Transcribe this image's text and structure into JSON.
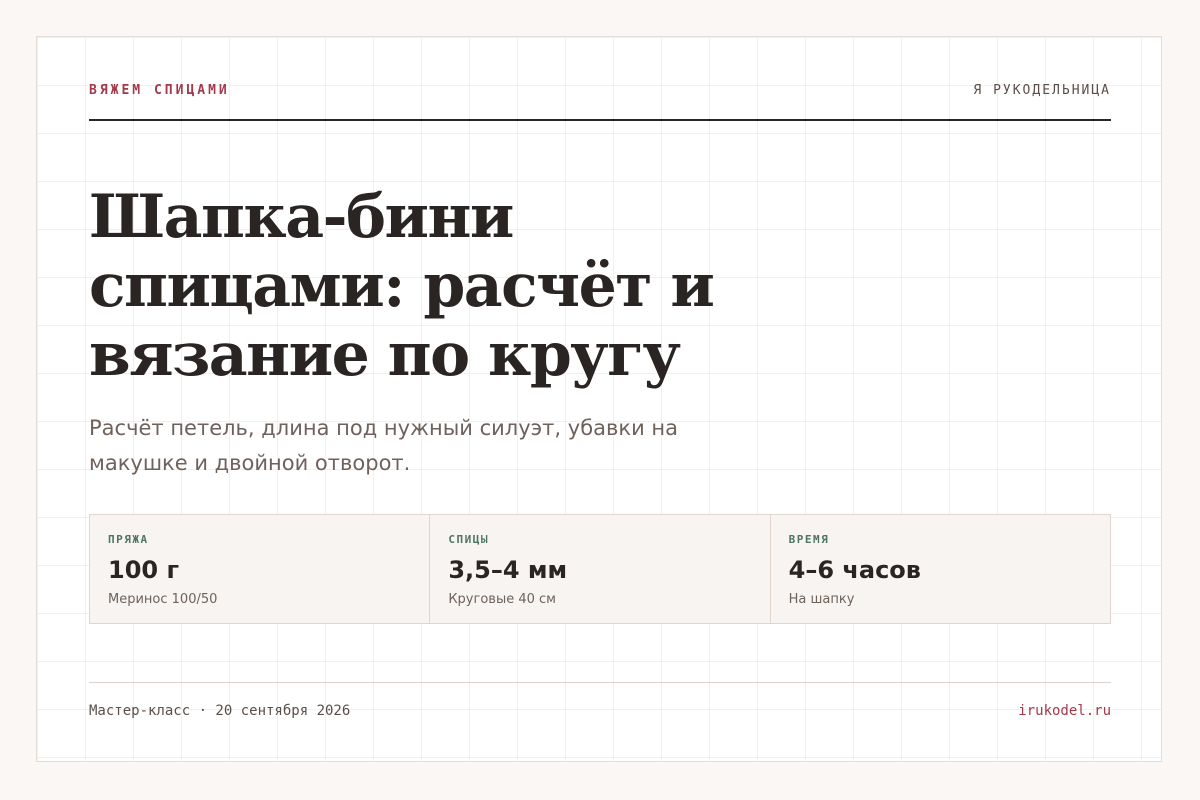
{
  "header": {
    "kicker": "ВЯЖЕМ СПИЦАМИ",
    "brand": "Я РУКОДЕЛЬНИЦА"
  },
  "article": {
    "title": "Шапка-бини спицами: расчёт и вязание по кругу",
    "subtitle": "Расчёт петель, длина под нужный силуэт, убавки на макушке и двойной отворот."
  },
  "stats": [
    {
      "label": "ПРЯЖА",
      "value": "100 г",
      "note": "Меринос 100/50"
    },
    {
      "label": "СПИЦЫ",
      "value": "3,5–4 мм",
      "note": "Круговые 40 см"
    },
    {
      "label": "ВРЕМЯ",
      "value": "4–6 часов",
      "note": "На шапку"
    }
  ],
  "footer": {
    "date_line": "Мастер-класс · 20 сентября 2026",
    "site": "irukodel.ru"
  },
  "colors": {
    "accent": "#a33a4c",
    "label_green": "#4f7564",
    "text_dark": "#2a2523",
    "text_muted": "#6f625b",
    "background": "#faf7f4"
  }
}
